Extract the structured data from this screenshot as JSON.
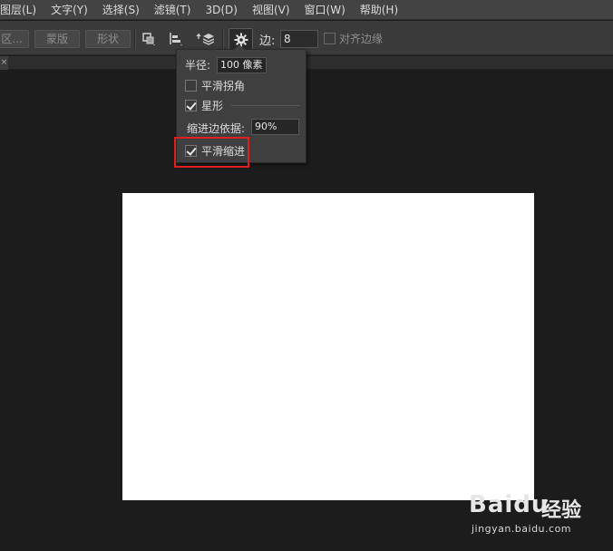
{
  "menubar": {
    "items": [
      "图层(L)",
      "文字(Y)",
      "选择(S)",
      "滤镜(T)",
      "3D(D)",
      "视图(V)",
      "窗口(W)",
      "帮助(H)"
    ]
  },
  "options_bar": {
    "selection_btn": "区...",
    "mask_btn": "蒙版",
    "shape_btn": "形状",
    "sides_label": "边:",
    "sides_value": "8",
    "align_edges_label": "对齐边缘",
    "icons": [
      "path-operations-icon",
      "path-alignment-icon",
      "path-arrangement-icon",
      "gear-icon"
    ]
  },
  "polygon_options": {
    "radius_label": "半径:",
    "radius_value": "100 像素",
    "smooth_corners_label": "平滑拐角",
    "smooth_corners_checked": false,
    "star_label": "星形",
    "star_checked": true,
    "indent_label": "缩进边依据:",
    "indent_value": "90%",
    "smooth_indents_label": "平滑缩进",
    "smooth_indents_checked": true
  },
  "document": {
    "canvas_color": "#ffffff",
    "workspace_color": "#1c1c1c"
  },
  "highlight_color": "#e01e1e",
  "watermark": {
    "brand": "Baidu",
    "product": "经验",
    "url": "jingyan.baidu.com"
  }
}
